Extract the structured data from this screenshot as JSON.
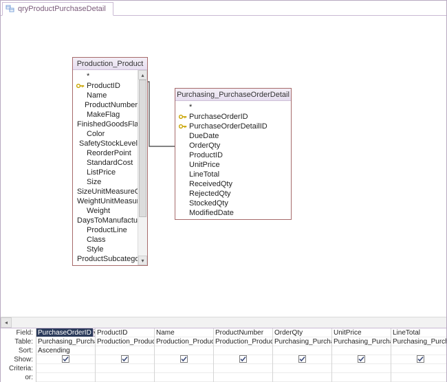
{
  "tab": {
    "title": "qryProductPurchaseDetail"
  },
  "tables": {
    "production_product": {
      "title": "Production_Product",
      "fields": [
        {
          "name": "*",
          "key": false
        },
        {
          "name": "ProductID",
          "key": true
        },
        {
          "name": "Name",
          "key": false
        },
        {
          "name": "ProductNumber",
          "key": false
        },
        {
          "name": "MakeFlag",
          "key": false
        },
        {
          "name": "FinishedGoodsFlag",
          "key": false
        },
        {
          "name": "Color",
          "key": false
        },
        {
          "name": "SafetyStockLevel",
          "key": false
        },
        {
          "name": "ReorderPoint",
          "key": false
        },
        {
          "name": "StandardCost",
          "key": false
        },
        {
          "name": "ListPrice",
          "key": false
        },
        {
          "name": "Size",
          "key": false
        },
        {
          "name": "SizeUnitMeasureCode",
          "key": false
        },
        {
          "name": "WeightUnitMeasureCo",
          "key": false
        },
        {
          "name": "Weight",
          "key": false
        },
        {
          "name": "DaysToManufacture",
          "key": false
        },
        {
          "name": "ProductLine",
          "key": false
        },
        {
          "name": "Class",
          "key": false
        },
        {
          "name": "Style",
          "key": false
        },
        {
          "name": "ProductSubcategoryID",
          "key": false
        }
      ]
    },
    "purchasing_pod": {
      "title": "Purchasing_PurchaseOrderDetail",
      "fields": [
        {
          "name": "*",
          "key": false
        },
        {
          "name": "PurchaseOrderID",
          "key": true
        },
        {
          "name": "PurchaseOrderDetailID",
          "key": true
        },
        {
          "name": "DueDate",
          "key": false
        },
        {
          "name": "OrderQty",
          "key": false
        },
        {
          "name": "ProductID",
          "key": false
        },
        {
          "name": "UnitPrice",
          "key": false
        },
        {
          "name": "LineTotal",
          "key": false
        },
        {
          "name": "ReceivedQty",
          "key": false
        },
        {
          "name": "RejectedQty",
          "key": false
        },
        {
          "name": "StockedQty",
          "key": false
        },
        {
          "name": "ModifiedDate",
          "key": false
        }
      ]
    }
  },
  "qbe": {
    "row_labels": [
      "Field:",
      "Table:",
      "Sort:",
      "Show:",
      "Criteria:",
      "or:"
    ],
    "columns": [
      {
        "field": "PurchaseOrderID",
        "table": "Purchasing_Purchase",
        "sort": "Ascending",
        "show": true,
        "selected": true
      },
      {
        "field": "ProductID",
        "table": "Production_Product",
        "sort": "",
        "show": true,
        "selected": false
      },
      {
        "field": "Name",
        "table": "Production_Product",
        "sort": "",
        "show": true,
        "selected": false
      },
      {
        "field": "ProductNumber",
        "table": "Production_Product",
        "sort": "",
        "show": true,
        "selected": false
      },
      {
        "field": "OrderQty",
        "table": "Purchasing_Purchase",
        "sort": "",
        "show": true,
        "selected": false
      },
      {
        "field": "UnitPrice",
        "table": "Purchasing_Purchase",
        "sort": "",
        "show": true,
        "selected": false
      },
      {
        "field": "LineTotal",
        "table": "Purchasing_Purchase",
        "sort": "",
        "show": true,
        "selected": false
      }
    ]
  }
}
